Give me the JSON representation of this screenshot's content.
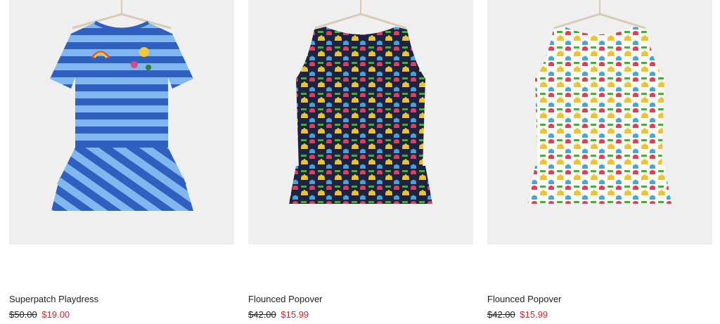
{
  "colors": {
    "sale": "#d2232a",
    "text": "#222222",
    "image_bg": "#efefef"
  },
  "products": [
    {
      "name": "Superpatch Playdress",
      "original_price": "$50.00",
      "sale_price": "$19.00",
      "image_icon": "dress-image"
    },
    {
      "name": "Flounced Popover",
      "original_price": "$42.00",
      "sale_price": "$15.99",
      "image_icon": "top-image"
    },
    {
      "name": "Flounced Popover",
      "original_price": "$42.00",
      "sale_price": "$15.99",
      "image_icon": "top-image"
    }
  ]
}
